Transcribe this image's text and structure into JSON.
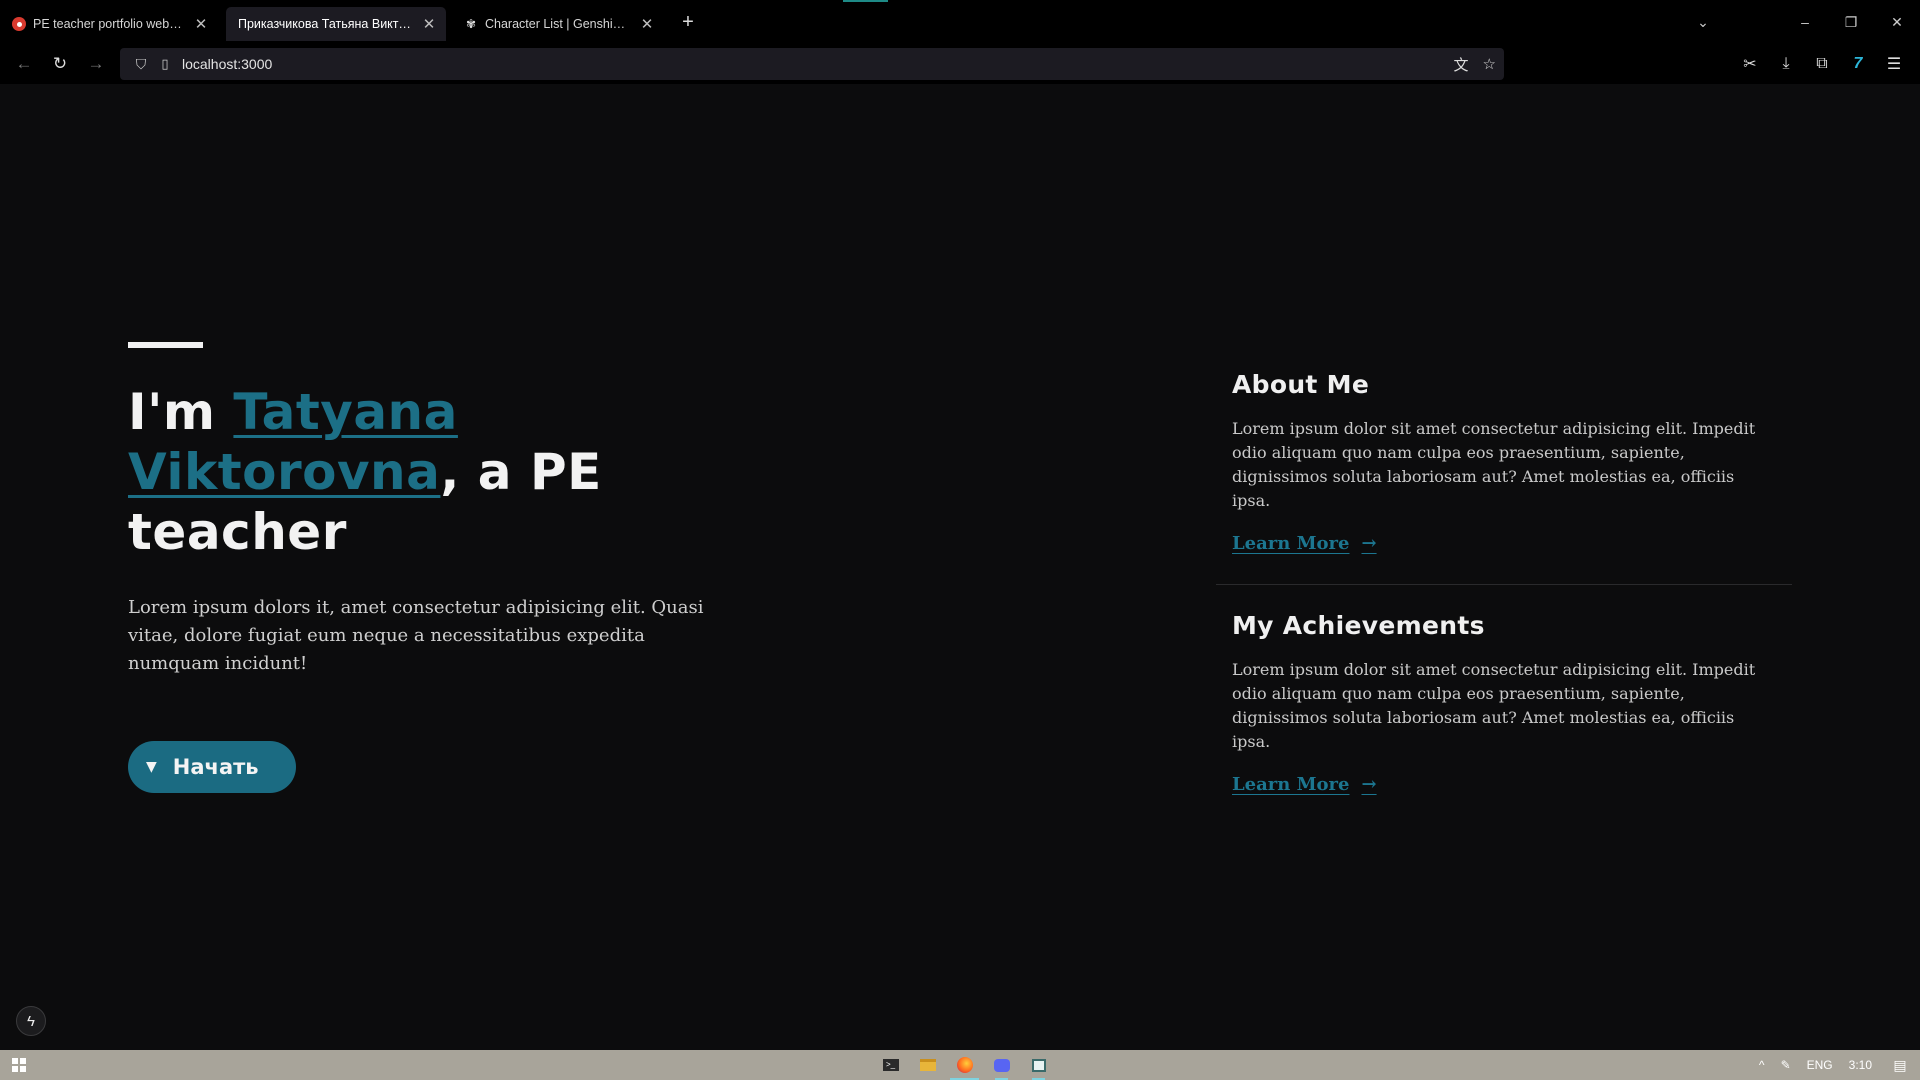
{
  "browser": {
    "tabs": [
      {
        "title": "PE teacher portfolio website at ",
        "active": false
      },
      {
        "title": "Приказчикова Татьяна Викторовн",
        "active": true
      },
      {
        "title": "Character List | Genshin Impact",
        "active": false
      }
    ],
    "url": "localhost:3000"
  },
  "hero": {
    "title_prefix": "I'm ",
    "name": "Tatyana Viktorovna",
    "title_suffix": ", a PE teacher",
    "body": "Lorem ipsum dolors it, amet consectetur adipisicing elit. Quasi vitae, dolore fugiat eum neque a necessitatibus expedita numquam incidunt!",
    "cta_label": "Начать"
  },
  "sections": [
    {
      "heading": "About Me",
      "body": "Lorem ipsum dolor sit amet consectetur adipisicing elit. Impedit odio aliquam quo nam culpa eos praesentium, sapiente, dignissimos soluta laboriosam aut? Amet molestias ea, officiis ipsa.",
      "link": "Learn More"
    },
    {
      "heading": "My Achievements",
      "body": "Lorem ipsum dolor sit amet consectetur adipisicing elit. Impedit odio aliquam quo nam culpa eos praesentium, sapiente, dignissimos soluta laboriosam aut? Amet molestias ea, officiis ipsa.",
      "link": "Learn More"
    }
  ],
  "taskbar": {
    "language": "ENG",
    "time": "3:10"
  },
  "colors": {
    "accent": "#1c6f86",
    "background": "#0c0c0d",
    "taskbar": "#a8a49a"
  },
  "icons": {
    "tab_close": "close-icon",
    "new_tab": "plus-icon",
    "back": "arrow-left-icon",
    "reload": "reload-icon",
    "forward": "arrow-right-icon",
    "shield": "shield-icon",
    "translate": "translate-icon",
    "bookmark": "star-icon",
    "learn_more_arrow": "arrow-right-icon",
    "cta_caret": "caret-down-icon"
  }
}
